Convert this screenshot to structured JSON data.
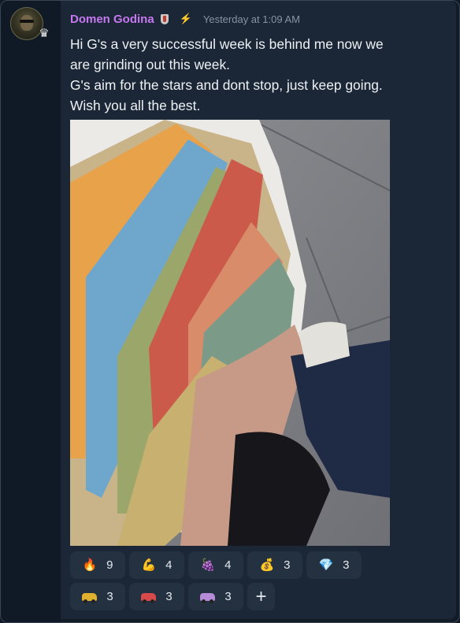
{
  "post": {
    "username": "Domen Godina",
    "timestamp": "Yesterday at 1:09 AM",
    "lines": [
      "Hi G's a very successful week is behind me now we",
      "are grinding out this week.",
      "G's aim for the stars and dont stop, just keep going.",
      "Wish you all the best."
    ],
    "avatar_badge_icon": "crown-icon",
    "badges": [
      "shield-badge-icon",
      "lightning-bolt-icon"
    ]
  },
  "reactions": {
    "row1": [
      {
        "icon": "fire-icon",
        "glyph": "🔥",
        "count": "9"
      },
      {
        "icon": "flexed-biceps-icon",
        "glyph": "💪",
        "count": "4"
      },
      {
        "icon": "grapes-icon",
        "glyph": "🍇",
        "count": "4"
      },
      {
        "icon": "money-bag-icon",
        "glyph": "💰",
        "count": "3"
      },
      {
        "icon": "diamond-icon",
        "glyph": "💎",
        "count": "3"
      }
    ],
    "row2": [
      {
        "icon": "gold-car-icon",
        "color": "#e0b12f",
        "count": "3"
      },
      {
        "icon": "red-car-icon",
        "color": "#d84a4a",
        "count": "3"
      },
      {
        "icon": "purple-car-icon",
        "color": "#b58bd8",
        "count": "3"
      }
    ],
    "add_label": "+"
  },
  "colors": {
    "username": "#c678f0",
    "background": "#1b2736",
    "reaction_pill": "#243141"
  }
}
